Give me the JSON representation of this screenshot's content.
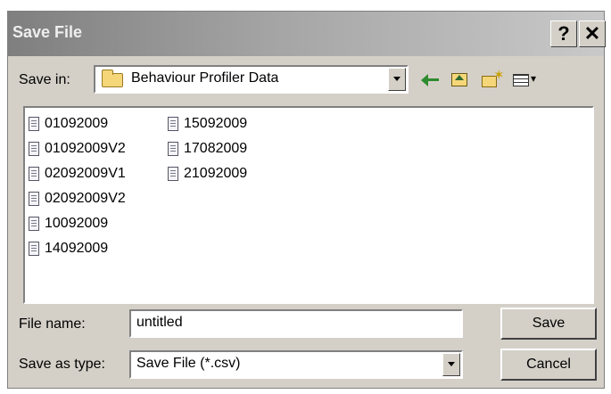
{
  "dialog": {
    "title": "Save File",
    "help_label": "?",
    "close_label": "✕"
  },
  "save_in": {
    "label": "Save in:",
    "value": "Behaviour Profiler Data"
  },
  "toolbar": {
    "icons": [
      "back-icon",
      "up-folder-icon",
      "new-folder-icon",
      "view-menu-icon"
    ]
  },
  "files": {
    "column1": [
      "01092009",
      "01092009V2",
      "02092009V1",
      "02092009V2",
      "10092009",
      "14092009"
    ],
    "column2": [
      "15092009",
      "17082009",
      "21092009"
    ]
  },
  "file_name": {
    "label": "File name:",
    "value": "untitled"
  },
  "save_as_type": {
    "label": "Save as type:",
    "value": "Save File (*.csv)"
  },
  "buttons": {
    "save": "Save",
    "cancel": "Cancel"
  },
  "colors": {
    "dialog_face": "#d4d0c8",
    "titlebar_start": "#7f7f7f",
    "titlebar_end": "#c9c9c9"
  }
}
